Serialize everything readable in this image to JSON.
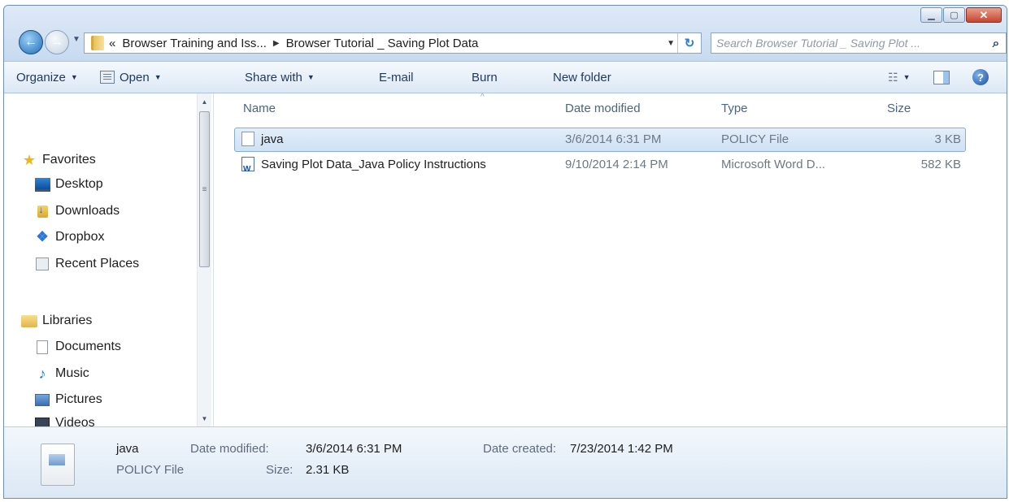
{
  "window": {
    "caption_buttons": [
      "minimize",
      "maximize",
      "close"
    ]
  },
  "address_bar": {
    "overflow_marker": "«",
    "crumbs": [
      "Browser Training and Iss...",
      "Browser Tutorial _ Saving Plot Data"
    ]
  },
  "search": {
    "placeholder": "Search Browser Tutorial _ Saving Plot ..."
  },
  "toolbar": {
    "organize": "Organize",
    "open": "Open",
    "share_with": "Share with",
    "email": "E-mail",
    "burn": "Burn",
    "new_folder": "New folder"
  },
  "nav": {
    "favorites_label": "Favorites",
    "favorites": [
      "Desktop",
      "Downloads",
      "Dropbox",
      "Recent Places"
    ],
    "libraries_label": "Libraries",
    "libraries": [
      "Documents",
      "Music",
      "Pictures",
      "Videos"
    ]
  },
  "columns": {
    "name": "Name",
    "date_modified": "Date modified",
    "type": "Type",
    "size": "Size"
  },
  "files": [
    {
      "name": "java",
      "date": "3/6/2014 6:31 PM",
      "type": "POLICY File",
      "size": "3 KB",
      "icon": "policy-file-icon",
      "selected": true
    },
    {
      "name": "Saving Plot Data_Java Policy Instructions",
      "date": "9/10/2014 2:14 PM",
      "type": "Microsoft Word D...",
      "size": "582 KB",
      "icon": "word-document-icon",
      "selected": false
    }
  ],
  "details": {
    "name": "java",
    "type": "POLICY File",
    "modified_label": "Date modified:",
    "modified_value": "3/6/2014 6:31 PM",
    "size_label": "Size:",
    "size_value": "2.31 KB",
    "created_label": "Date created:",
    "created_value": "7/23/2014 1:42 PM"
  },
  "colors": {
    "selection": "#cfe1f4",
    "toolbar_text": "#1e395b",
    "header_text": "#4b6585"
  }
}
